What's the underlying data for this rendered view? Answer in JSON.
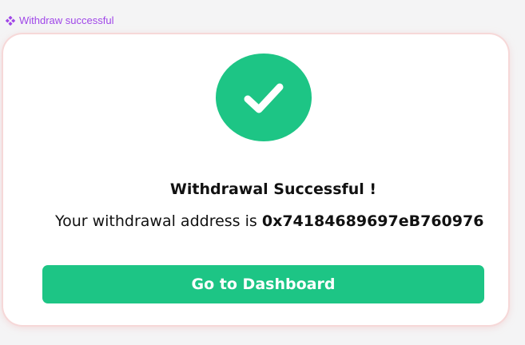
{
  "frame": {
    "label": "Withdraw successful",
    "icon": "component-icon",
    "label_color": "#a047e8"
  },
  "dialog": {
    "status_icon": "checkmark-icon",
    "accent_color": "#1dc585",
    "title": "Withdrawal Successful !",
    "message_prefix": "Your withdrawal address is ",
    "address": "0x74184689697eB760976",
    "button_label": "Go to Dashboard"
  }
}
